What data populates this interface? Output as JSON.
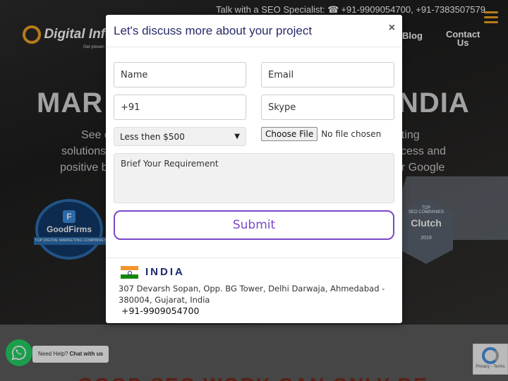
{
  "topbar": {
    "text": "Talk with a SEO Specialist:",
    "phone_icon": "phone-icon",
    "phones": "+91-9909054700, +91-7383507579"
  },
  "logo": {
    "name": "Digital Infow",
    "tagline": "Get presen"
  },
  "nav": {
    "blog": "Blog",
    "contact_line1": "Contact",
    "contact_line2": "Us"
  },
  "hero": {
    "title_left": "MAR",
    "title_right": "NDIA",
    "sub_lines": [
      {
        "left": "See o",
        "right": "eting"
      },
      {
        "left": "solutions",
        "right": "ccess and"
      },
      {
        "left": "positive b",
        "right": "ur Google"
      }
    ]
  },
  "badges": {
    "goodfirms": {
      "name": "GoodFirms",
      "ribbon": "TOP DIGITAL MARKETING COMPANIES"
    },
    "clutch": {
      "top": "TOP",
      "seo": "SEO COMPANIES",
      "name": "Clutch",
      "year": "2019"
    }
  },
  "lower": {
    "heading": "GOOD SEO WORK CAN ONLY BE"
  },
  "whatsapp": {
    "need_help": "Need Help?",
    "chat": "Chat with us"
  },
  "recaptcha": {
    "text": "Privacy - Terms"
  },
  "modal": {
    "title": "Let's discuss more about your project",
    "close": "×",
    "fields": {
      "name_placeholder": "Name",
      "email_placeholder": "Email",
      "phone_value": "+91",
      "skype_placeholder": "Skype",
      "budget_selected": "Less then $500",
      "file_button": "Choose File",
      "file_status": "No file chosen",
      "requirement_placeholder": "Brief Your Requirement"
    },
    "submit": "Submit",
    "office": {
      "country": "INDIA",
      "address": "307 Devarsh Sopan, Opp. BG Tower, Delhi Darwaja, Ahmedabad - 380004, Gujarat, India",
      "phone": "+91-9909054700"
    }
  },
  "colors": {
    "accent": "#7b48c8",
    "brand_orange": "#f5a623",
    "title_navy": "#2a2a6a",
    "whatsapp_green": "#25d366"
  }
}
